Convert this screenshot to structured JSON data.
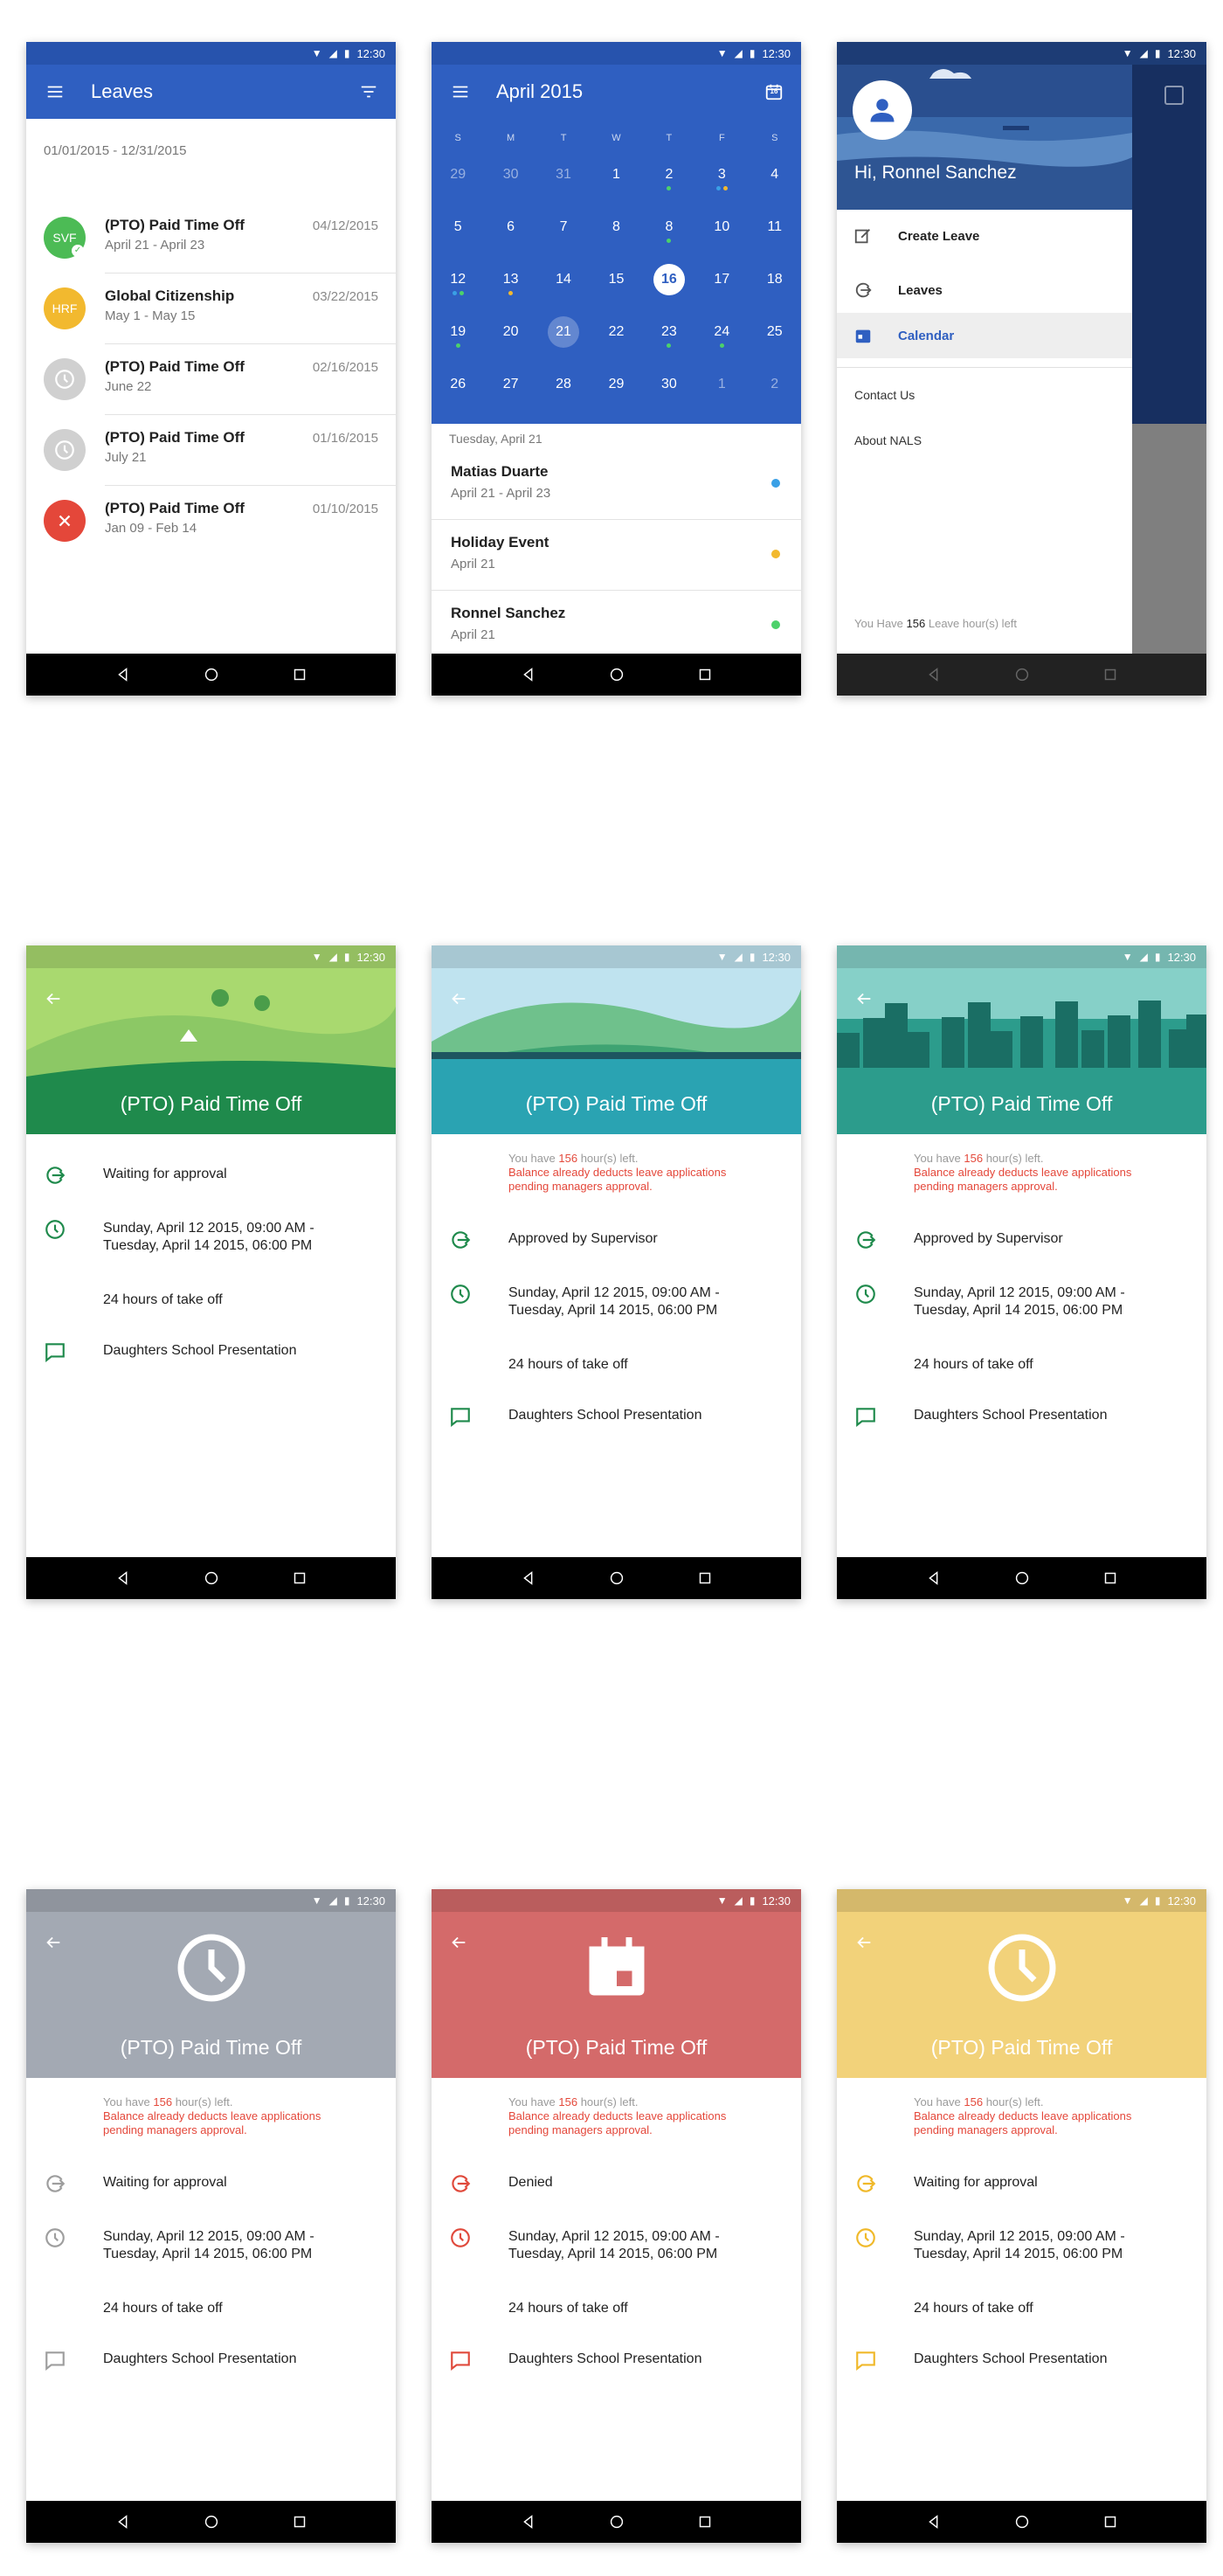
{
  "status": {
    "time": "12:30"
  },
  "leaves_screen": {
    "title": "Leaves",
    "range": "01/01/2015 - 12/31/2015",
    "items": [
      {
        "badge": "SVF",
        "title": "(PTO)  Paid Time Off",
        "dates": "April 21 - April 23",
        "date": "04/12/2015",
        "color": "#4cbb55",
        "state": "approved"
      },
      {
        "badge": "HRF",
        "title": "Global Citizenship",
        "dates": "May 1 - May 15",
        "date": "03/22/2015",
        "color": "#f2b92f",
        "state": "text"
      },
      {
        "badge": "",
        "title": "(PTO)  Paid Time Off",
        "dates": "June 22",
        "date": "02/16/2015",
        "color": "#d0d0d0",
        "state": "clock"
      },
      {
        "badge": "",
        "title": "(PTO)  Paid Time Off",
        "dates": "July 21",
        "date": "01/16/2015",
        "color": "#d0d0d0",
        "state": "clock"
      },
      {
        "badge": "",
        "title": "(PTO)  Paid Time Off",
        "dates": "Jan 09 - Feb 14",
        "date": "01/10/2015",
        "color": "#e4473a",
        "state": "denied"
      }
    ]
  },
  "calendar_screen": {
    "title": "April 2015",
    "calendar_icon_label": "16",
    "weekdays": [
      "S",
      "M",
      "T",
      "W",
      "T",
      "F",
      "S"
    ],
    "weeks": [
      [
        "29",
        "30",
        "31",
        "1",
        "2",
        "3",
        "4"
      ],
      [
        "5",
        "6",
        "7",
        "8",
        "8",
        "10",
        "11"
      ],
      [
        "12",
        "13",
        "14",
        "15",
        "16",
        "17",
        "18"
      ],
      [
        "19",
        "20",
        "21",
        "22",
        "23",
        "24",
        "25"
      ],
      [
        "26",
        "27",
        "28",
        "29",
        "30",
        "1",
        "2"
      ]
    ],
    "selected_day_label": "Tuesday, April 21",
    "events": [
      {
        "title": "Matias Duarte",
        "dates": "April 21 - April 23",
        "color": "#3aa0e6"
      },
      {
        "title": "Holiday Event",
        "dates": "April 21",
        "color": "#f2b92f"
      },
      {
        "title": "Ronnel Sanchez",
        "dates": "April 21",
        "color": "#4cd16a"
      }
    ]
  },
  "drawer_screen": {
    "greeting": "Hi, Ronnel Sanchez",
    "items": [
      {
        "label": "Create Leave",
        "icon": "edit-icon"
      },
      {
        "label": "Leaves",
        "icon": "leave-arrow-icon"
      },
      {
        "label": "Calendar",
        "icon": "calendar-icon"
      }
    ],
    "links": [
      "Contact Us",
      "About NALS"
    ],
    "footer_prefix": "You Have",
    "footer_hours": "156",
    "footer_suffix": "Leave hour(s) left"
  },
  "detail_common": {
    "title": "(PTO) Paid Time Off",
    "balance_prefix": "You have",
    "balance_hours": "156",
    "balance_suffix": "hour(s) left.",
    "balance_note_1": "Balance already deducts leave applications",
    "balance_note_2": "pending managers approval.",
    "dates_1": "Sunday, April 12 2015, 09:00 AM -",
    "dates_2": "Tuesday, April 14 2015, 06:00 PM",
    "hours": "24 hours of take off",
    "reason": "Daughters School Presentation"
  },
  "detail_screens": [
    {
      "status": "Waiting for approval",
      "hero_color": "#8cc865",
      "icon_color": "#1f8a4c",
      "show_balance": false
    },
    {
      "status": "Approved by Supervisor",
      "hero_color": "#4ba7b5",
      "icon_color": "#1f8a4c",
      "show_balance": true
    },
    {
      "status": "Approved by Supervisor",
      "hero_color": "#2c9c8c",
      "icon_color": "#1f8a4c",
      "show_balance": true
    },
    {
      "status": "Waiting for approval",
      "hero_color": "#a3a9b3",
      "icon_color": "#9e9e9e",
      "show_balance": true
    },
    {
      "status": "Denied",
      "hero_color": "#d46a6a",
      "icon_color": "#e04a3c",
      "show_balance": true
    },
    {
      "status": "Waiting for approval",
      "hero_color": "#f2d27a",
      "icon_color": "#f0b92a",
      "show_balance": true
    }
  ]
}
